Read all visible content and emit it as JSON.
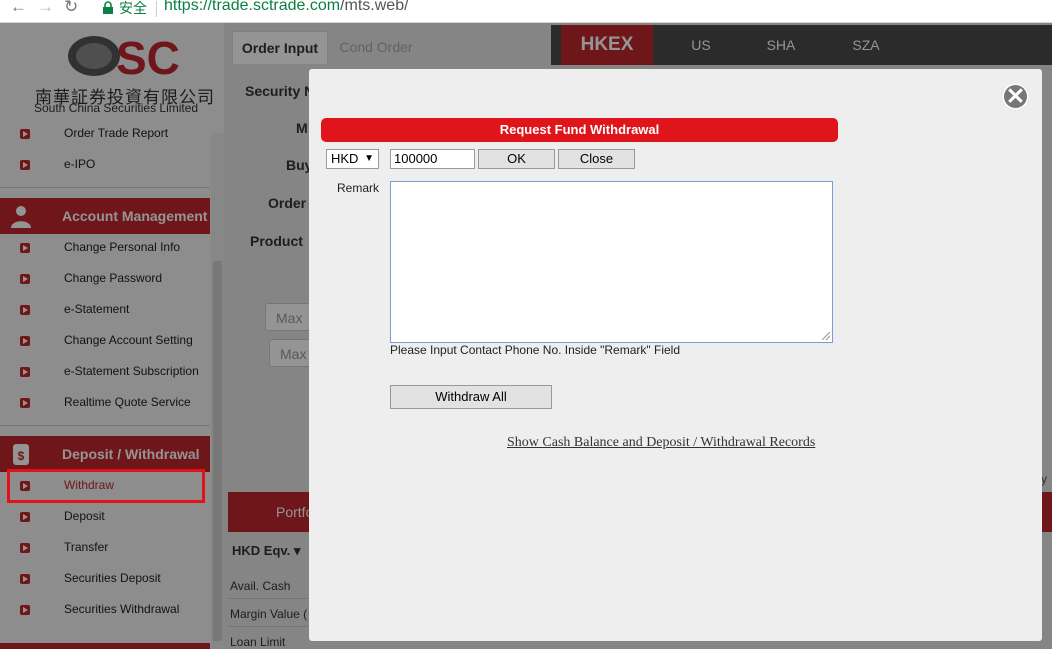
{
  "browser": {
    "secure_label": "安全",
    "url_host": "https://trade.sctrade.com",
    "url_path": "/mts.web/"
  },
  "logo": {
    "brand": "SC",
    "chinese_name": "南華証券投資有限公司",
    "english_name": "South China Securities Limited"
  },
  "sidebar": {
    "top_items": [
      {
        "label": "Order Trade Report"
      },
      {
        "label": "e-IPO"
      }
    ],
    "account_management": {
      "title": "Account Management",
      "items": [
        {
          "label": "Change Personal Info"
        },
        {
          "label": "Change Password"
        },
        {
          "label": "e-Statement"
        },
        {
          "label": "Change Account Setting"
        },
        {
          "label": "e-Statement Subscription"
        },
        {
          "label": "Realtime Quote Service"
        }
      ]
    },
    "deposit_withdrawal": {
      "title": "Deposit / Withdrawal",
      "items": [
        {
          "label": "Withdraw"
        },
        {
          "label": "Deposit"
        },
        {
          "label": "Transfer"
        },
        {
          "label": "Securities Deposit"
        },
        {
          "label": "Securities Withdrawal"
        }
      ]
    }
  },
  "main": {
    "tabs": [
      {
        "label": "Order Input"
      },
      {
        "label": "Cond Order"
      }
    ],
    "markets": [
      {
        "label": "HKEX"
      },
      {
        "label": "US"
      },
      {
        "label": "SHA"
      },
      {
        "label": "SZA"
      }
    ],
    "form_labels": {
      "security": "Security N",
      "m": "M",
      "buy": "Buy",
      "order": "Order",
      "product": "Product"
    },
    "max1": "Max",
    "max2": "Max",
    "portfolio_tab": "Portfo",
    "hkd_eqv": "HKD Eqv. ▾",
    "rows": [
      {
        "label": "Avail. Cash"
      },
      {
        "label": "Margin Value ("
      },
      {
        "label": "Loan Limit"
      }
    ],
    "right_fragment": "y"
  },
  "modal": {
    "title": "Request Fund Withdrawal",
    "currency": "HKD",
    "amount": "100000",
    "ok_label": "OK",
    "close_label": "Close",
    "remark_label": "Remark",
    "remark_value": "",
    "hint": "Please Input Contact Phone No. Inside \"Remark\" Field",
    "withdraw_all_label": "Withdraw All",
    "records_link": "Show Cash Balance and Deposit / Withdrawal Records"
  },
  "colors": {
    "brand_red": "#c0272d",
    "banner_red": "#e0141b",
    "market_bar": "#4a4a4a",
    "highlight_box": "#e0121a"
  },
  "icons": [
    "back-arrow-icon",
    "forward-arrow-icon",
    "reload-icon",
    "lock-icon",
    "bullet-arrow-icon",
    "user-group-icon",
    "money-icon",
    "close-circle-icon",
    "select-caret-icon",
    "resize-grip-icon"
  ]
}
